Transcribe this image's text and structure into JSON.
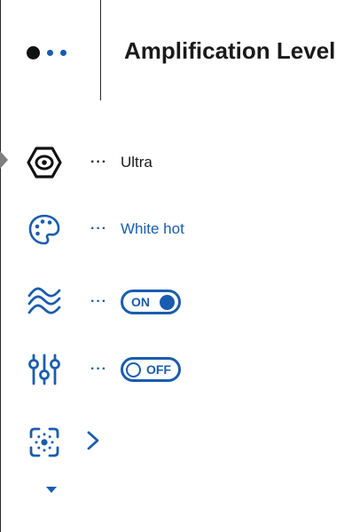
{
  "header": {
    "title": "Amplification Level",
    "page_indicator": {
      "total": 3,
      "active": 1
    }
  },
  "menu": {
    "items": [
      {
        "name": "amplification",
        "icon": "hexagon-amplification-icon",
        "value": "Ultra",
        "separator": "···"
      },
      {
        "name": "color-palette",
        "icon": "palette-icon",
        "value": "White hot",
        "separator": "···"
      },
      {
        "name": "smoothing",
        "icon": "waves-icon",
        "toggle": "ON",
        "separator": "···"
      },
      {
        "name": "equalizer",
        "icon": "sliders-icon",
        "toggle": "OFF",
        "separator": "···"
      },
      {
        "name": "calibration",
        "icon": "calibration-icon",
        "submenu": "chevron-right-icon"
      }
    ],
    "more_indicator": "chevron-down-icon"
  },
  "colors": {
    "accent": "#1a5cb0",
    "text": "#1a1a1a",
    "pointer": "#7f7f7f"
  }
}
